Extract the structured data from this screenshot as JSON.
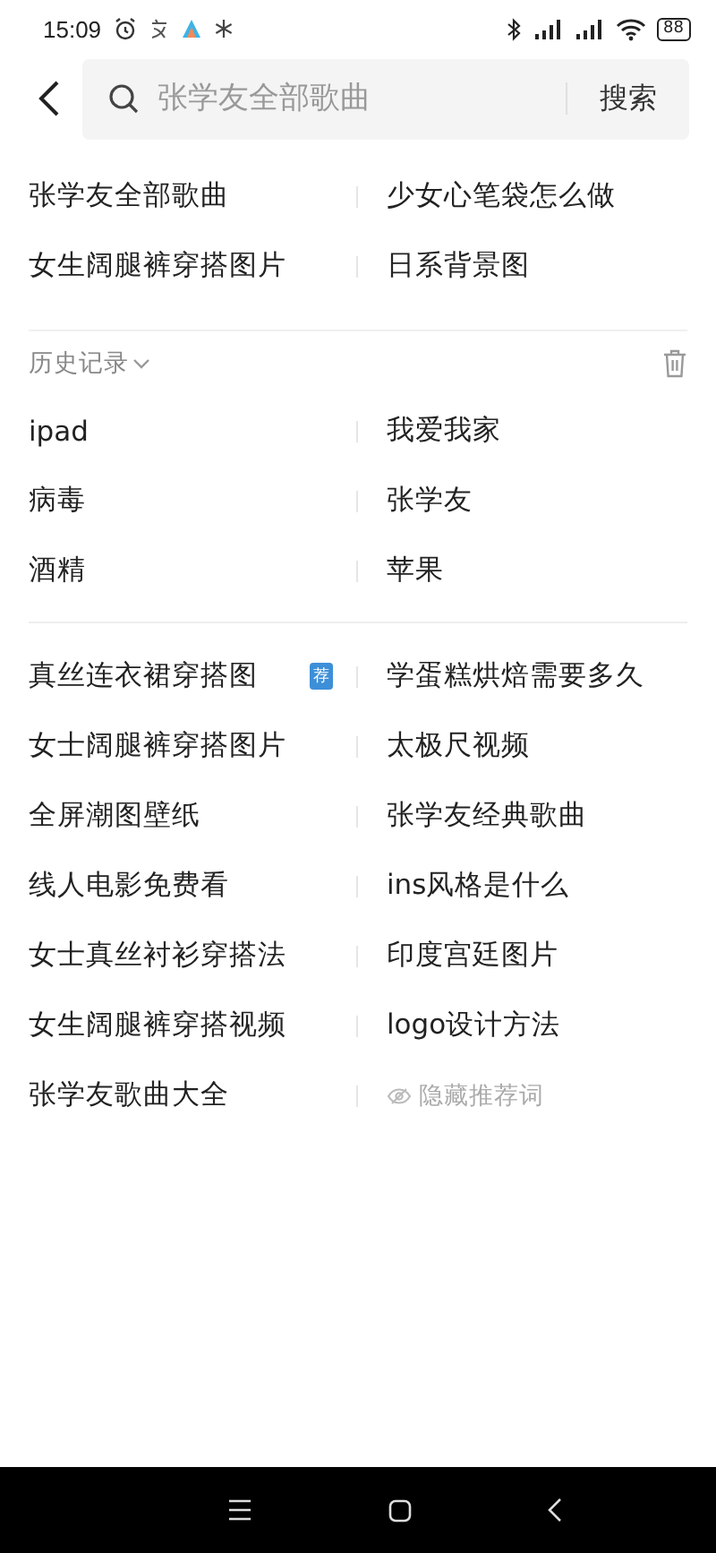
{
  "status_bar": {
    "time": "15:09",
    "battery": "88"
  },
  "search": {
    "placeholder": "张学友全部歌曲",
    "button": "搜索"
  },
  "suggestions": [
    {
      "kind": "term",
      "text": "张学友全部歌曲"
    },
    {
      "kind": "term",
      "text": "少女心笔袋怎么做"
    },
    {
      "kind": "term",
      "text": "女生阔腿裤穿搭图片"
    },
    {
      "kind": "term",
      "text": "日系背景图"
    }
  ],
  "history": {
    "title": "历史记录",
    "items": [
      {
        "kind": "term",
        "text": "ipad"
      },
      {
        "kind": "term",
        "text": "我爱我家"
      },
      {
        "kind": "term",
        "text": "病毒"
      },
      {
        "kind": "term",
        "text": "张学友"
      },
      {
        "kind": "term",
        "text": "酒精"
      },
      {
        "kind": "term",
        "text": "苹果"
      }
    ]
  },
  "recommendations": [
    {
      "kind": "term",
      "text": "真丝连衣裙穿搭图",
      "badge": "荐"
    },
    {
      "kind": "term",
      "text": "学蛋糕烘焙需要多久"
    },
    {
      "kind": "term",
      "text": "女士阔腿裤穿搭图片"
    },
    {
      "kind": "term",
      "text": "太极尺视频"
    },
    {
      "kind": "term",
      "text": "全屏潮图壁纸"
    },
    {
      "kind": "term",
      "text": "张学友经典歌曲"
    },
    {
      "kind": "term",
      "text": "线人电影免费看"
    },
    {
      "kind": "term",
      "text": "ins风格是什么"
    },
    {
      "kind": "term",
      "text": "女士真丝衬衫穿搭法"
    },
    {
      "kind": "term",
      "text": "印度宫廷图片"
    },
    {
      "kind": "term",
      "text": "女生阔腿裤穿搭视频"
    },
    {
      "kind": "term",
      "text": "logo设计方法"
    },
    {
      "kind": "term",
      "text": "张学友歌曲大全"
    },
    {
      "kind": "action",
      "text": "隐藏推荐词"
    }
  ]
}
